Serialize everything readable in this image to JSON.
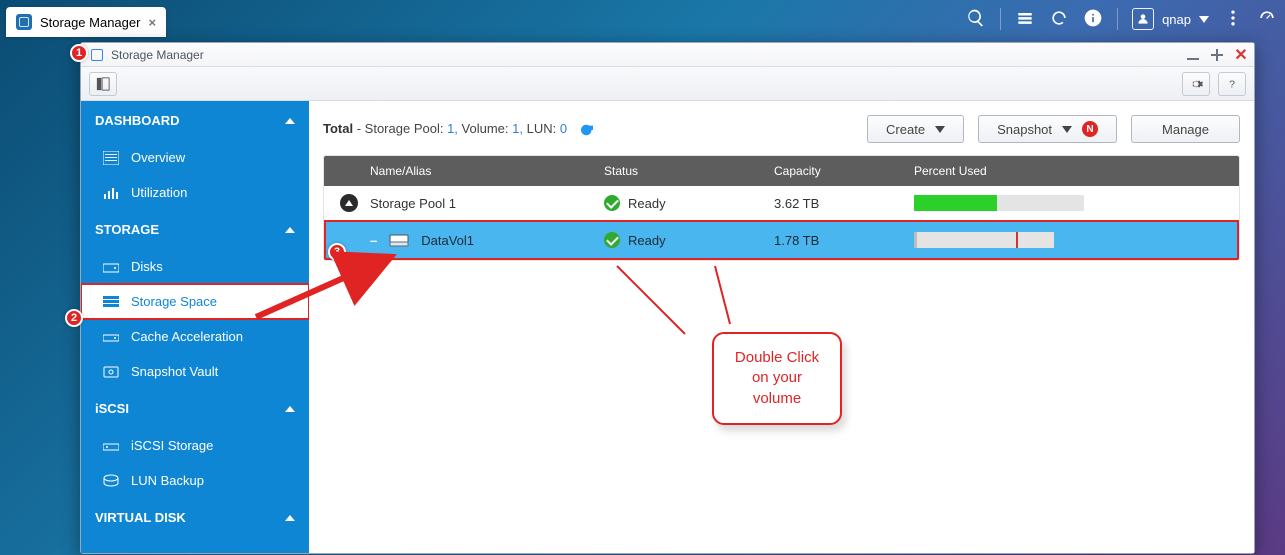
{
  "topbar": {
    "tab_label": "Storage Manager",
    "user_name": "qnap"
  },
  "window": {
    "title": "Storage Manager"
  },
  "sidebar": {
    "groups": [
      {
        "label": "DASHBOARD",
        "items": [
          {
            "label": "Overview"
          },
          {
            "label": "Utilization"
          }
        ]
      },
      {
        "label": "STORAGE",
        "items": [
          {
            "label": "Disks"
          },
          {
            "label": "Storage Space"
          },
          {
            "label": "Cache Acceleration"
          },
          {
            "label": "Snapshot Vault"
          }
        ]
      },
      {
        "label": "iSCSI",
        "items": [
          {
            "label": "iSCSI Storage"
          },
          {
            "label": "LUN Backup"
          }
        ]
      },
      {
        "label": "VIRTUAL DISK",
        "items": []
      }
    ]
  },
  "content": {
    "total_label": "Total",
    "total_parts": {
      "storage_pool_label": "Storage Pool:",
      "storage_pool_value": "1,",
      "volume_label": "Volume:",
      "volume_value": "1,",
      "lun_label": "LUN:",
      "lun_value": "0"
    },
    "buttons": {
      "create": "Create",
      "snapshot": "Snapshot",
      "snapshot_badge": "N",
      "manage": "Manage"
    },
    "columns": {
      "name": "Name/Alias",
      "status": "Status",
      "capacity": "Capacity",
      "percent": "Percent Used"
    },
    "rows": [
      {
        "type": "pool",
        "name": "Storage Pool 1",
        "status": "Ready",
        "capacity": "3.62 TB",
        "percent_fill": 49,
        "fill_color": "#2bd02b"
      },
      {
        "type": "volume",
        "name": "DataVol1",
        "status": "Ready",
        "capacity": "1.78 TB",
        "percent_fill": 2,
        "fill_color": "#bdbdbd",
        "mark_pct": 73
      }
    ]
  },
  "annotations": {
    "badge1": "1",
    "badge2": "2",
    "badge3": "3",
    "callout_line1": "Double Click",
    "callout_line2": "on your volume"
  }
}
